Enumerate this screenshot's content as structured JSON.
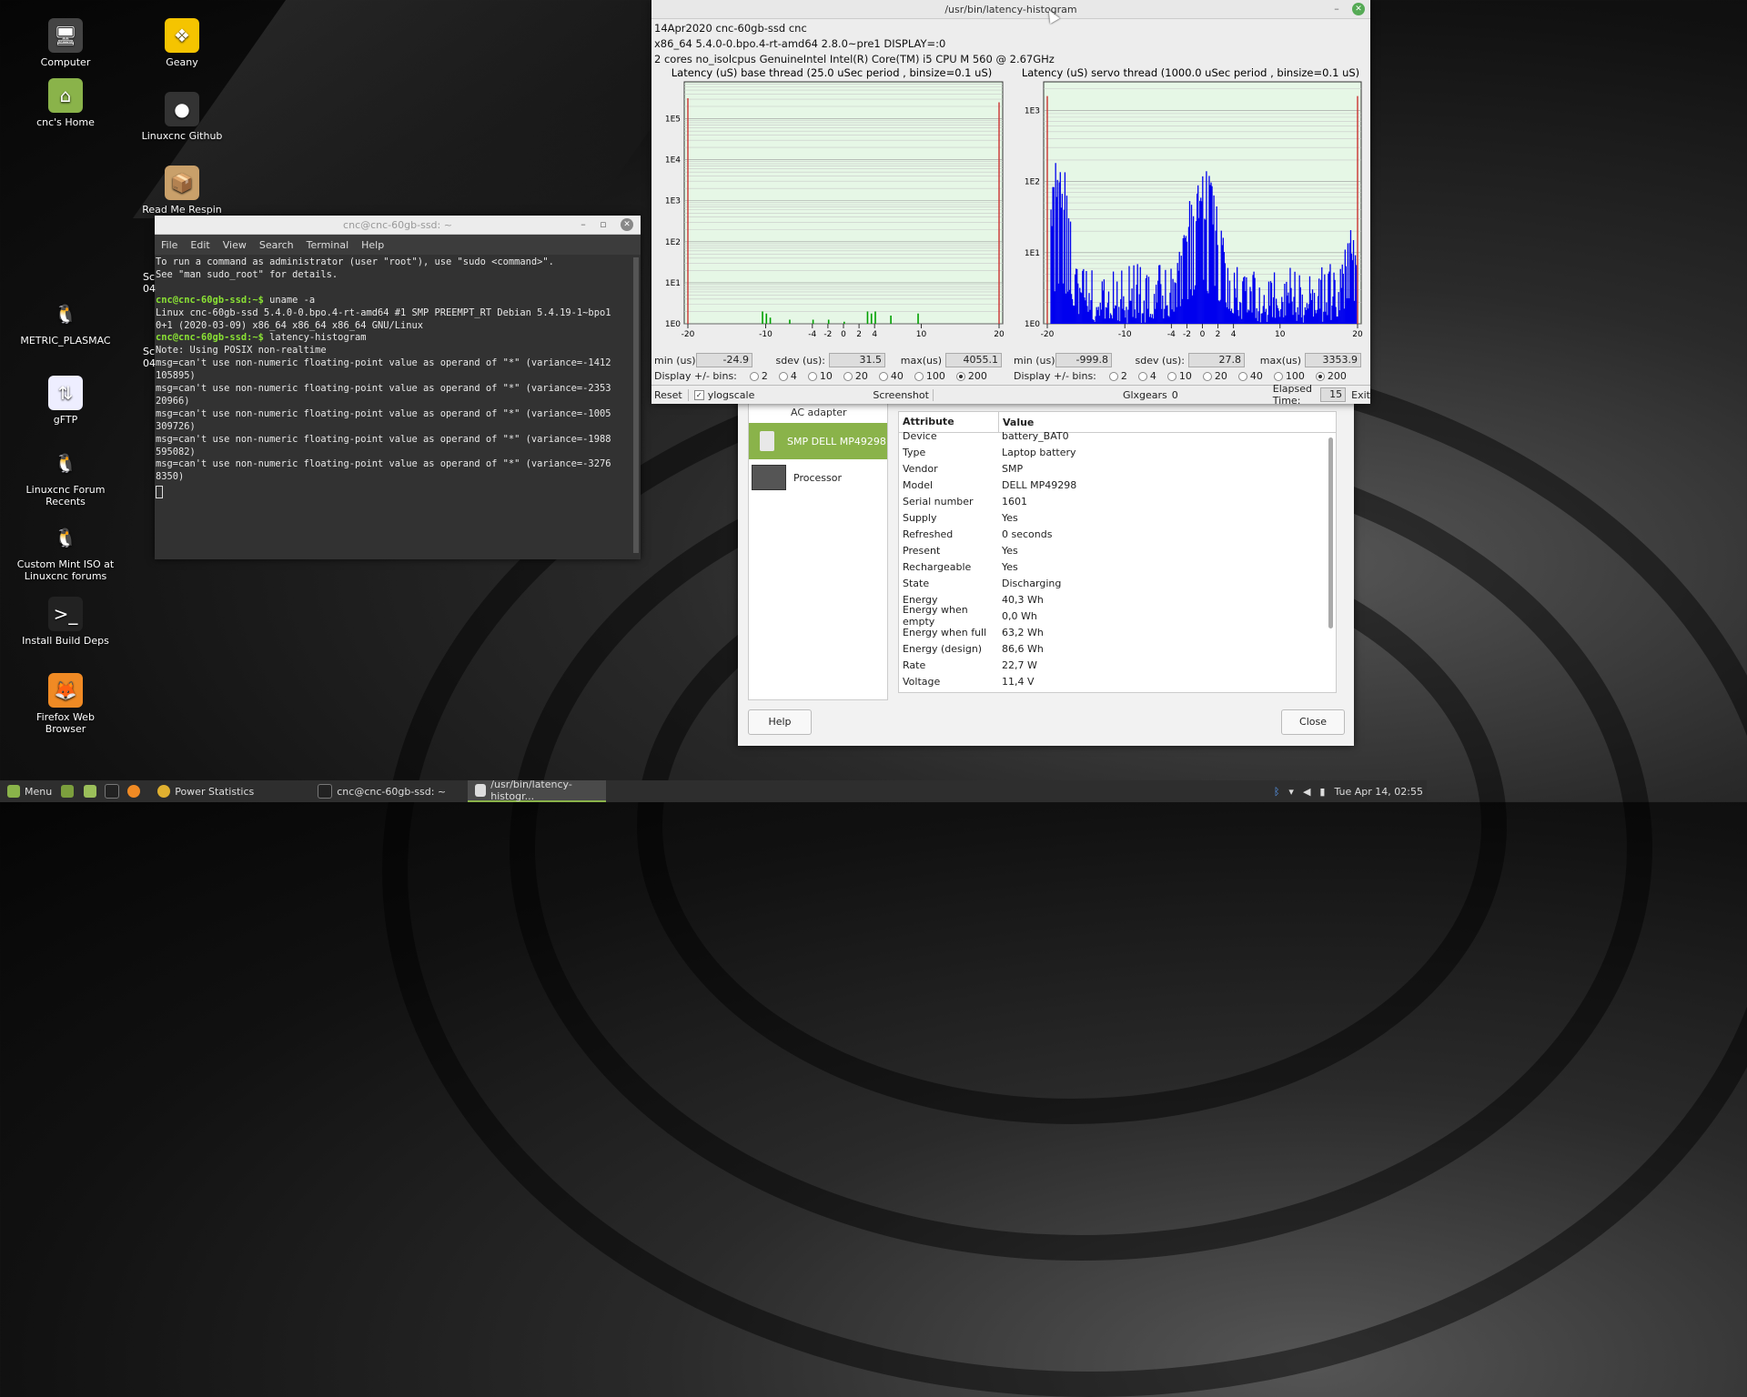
{
  "desktop": {
    "icons": [
      {
        "label": "Computer",
        "glyph": "🖥"
      },
      {
        "label": "cnc's Home",
        "glyph": "⌂"
      },
      {
        "label": "Geany",
        "glyph": "❖"
      },
      {
        "label": "Linuxcnc Github",
        "glyph": "●"
      },
      {
        "label": "Read Me Respin",
        "glyph": "📦"
      },
      {
        "label": "METRIC_PLASMAC",
        "glyph": "🐧"
      },
      {
        "label": "gFTP",
        "glyph": "⇅"
      },
      {
        "label": "Linuxcnc Forum Recents",
        "glyph": "🐧"
      },
      {
        "label": "Custom Mint ISO at Linuxcnc forums",
        "glyph": "🐧"
      },
      {
        "label": "Install Build Deps",
        "glyph": ">_"
      },
      {
        "label": "Firefox Web Browser",
        "glyph": "🦊"
      }
    ]
  },
  "terminal": {
    "title": "cnc@cnc-60gb-ssd: ~",
    "menu": [
      "File",
      "Edit",
      "View",
      "Search",
      "Terminal",
      "Help"
    ],
    "lines": [
      {
        "t": "To run a command as administrator (user \"root\"), use \"sudo <command>\"."
      },
      {
        "t": "See \"man sudo_root\" for details."
      },
      {
        "t": ""
      },
      {
        "p": "cnc@cnc-60gb-ssd:~$",
        "t": " uname -a"
      },
      {
        "t": "Linux cnc-60gb-ssd 5.4.0-0.bpo.4-rt-amd64 #1 SMP PREEMPT_RT Debian 5.4.19-1~bpo1"
      },
      {
        "t": "0+1 (2020-03-09) x86_64 x86_64 x86_64 GNU/Linux"
      },
      {
        "p": "cnc@cnc-60gb-ssd:~$",
        "t": " latency-histogram"
      },
      {
        "t": "Note: Using POSIX non-realtime"
      },
      {
        "t": "msg=can't use non-numeric floating-point value as operand of \"*\" (variance=-1412"
      },
      {
        "t": "105895)"
      },
      {
        "t": "msg=can't use non-numeric floating-point value as operand of \"*\" (variance=-2353"
      },
      {
        "t": "20966)"
      },
      {
        "t": "msg=can't use non-numeric floating-point value as operand of \"*\" (variance=-1005"
      },
      {
        "t": "309726)"
      },
      {
        "t": "msg=can't use non-numeric floating-point value as operand of \"*\" (variance=-1988"
      },
      {
        "t": "595082)"
      },
      {
        "t": "msg=can't use non-numeric floating-point value as operand of \"*\" (variance=-3276"
      },
      {
        "t": "8350)"
      }
    ],
    "partial_left": [
      "Sc",
      "04",
      "Sc",
      "04"
    ]
  },
  "latency": {
    "title": "/usr/bin/latency-histogram",
    "info": [
      "14Apr2020 cnc-60gb-ssd cnc",
      "x86_64  5.4.0-0.bpo.4-rt-amd64  2.8.0~pre1  DISPLAY=:0",
      "2 cores  no_isolcpus   GenuineIntel  Intel(R) Core(TM) i5 CPU M 560 @ 2.67GHz"
    ],
    "base": {
      "title": "Latency (uS) base thread (25.0 uSec period , binsize=0.1 uS)",
      "min_label": "min (us)",
      "min": "-24.9",
      "sdev_label": "sdev (us):",
      "sdev": "31.5",
      "max_label": "max(us)",
      "max": "4055.1"
    },
    "servo": {
      "title": "Latency (uS) servo thread (1000.0 uSec period , binsize=0.1 uS)",
      "min_label": "min (us)",
      "min": "-999.8",
      "sdev_label": "sdev (us):",
      "sdev": "27.8",
      "max_label": "max(us)",
      "max": "3353.9"
    },
    "bins_label": "Display +/- bins:",
    "bins": [
      "2",
      "4",
      "10",
      "20",
      "40",
      "100",
      "200"
    ],
    "bins_selected": "200",
    "reset": "Reset",
    "ylogscale": "ylogscale",
    "screenshot": "Screenshot",
    "glxgears_label": "Glxgears",
    "glxgears": "0",
    "elapsed_label": "Elapsed Time:",
    "elapsed": "15",
    "exit": "Exit"
  },
  "chart_data": [
    {
      "type": "bar",
      "title": "Latency (uS) base thread (25.0 uSec period , binsize=0.1 uS)",
      "x_ticks": [
        "-20",
        "-10",
        "-4",
        "-2",
        "0",
        "2",
        "4",
        "10",
        "20"
      ],
      "y_ticks": [
        "1E0",
        "1E1",
        "1E2",
        "1E3",
        "1E4",
        "1E5"
      ],
      "yscale": "log",
      "xlim": [
        -20,
        20
      ],
      "grid": true,
      "spikes": [
        {
          "x": -20,
          "log10": 5.5
        },
        {
          "x": 20,
          "log10": 5.4
        }
      ],
      "bars": [
        [
          -10.5,
          0.3
        ],
        [
          -10,
          0.25
        ],
        [
          -9.5,
          0.15
        ],
        [
          -7,
          0.1
        ],
        [
          -4,
          0.1
        ],
        [
          -2,
          0.1
        ],
        [
          0,
          0.05
        ],
        [
          3,
          0.3
        ],
        [
          3.5,
          0.25
        ],
        [
          4,
          0.3
        ],
        [
          6,
          0.2
        ],
        [
          9.5,
          0.25
        ]
      ]
    },
    {
      "type": "bar",
      "title": "Latency (uS) servo thread (1000.0 uSec period , binsize=0.1 uS)",
      "x_ticks": [
        "-20",
        "-10",
        "-4",
        "-2",
        "0",
        "2",
        "4",
        "10",
        "20"
      ],
      "y_ticks": [
        "1E0",
        "1E1",
        "1E2",
        "1E3"
      ],
      "yscale": "log",
      "xlim": [
        -20,
        20
      ],
      "grid": true,
      "spikes": [
        {
          "x": -20,
          "log10": 3.2
        },
        {
          "x": 20,
          "log10": 3.2
        }
      ],
      "peaks": [
        {
          "center": -18.5,
          "log10": 2.3,
          "width": 2.2
        },
        {
          "center": 0,
          "log10": 2.1,
          "width": 3.5
        },
        {
          "center": 19,
          "log10": 1.3,
          "width": 1.4
        }
      ],
      "floor_log10": 0.6
    }
  ],
  "power": {
    "devices": [
      {
        "label": "AC adapter"
      },
      {
        "label": "SMP DELL MP49298"
      },
      {
        "label": "Processor"
      }
    ],
    "header": {
      "attr": "Attribute",
      "value": "Value"
    },
    "rows": [
      {
        "a": "Device",
        "v": "battery_BAT0"
      },
      {
        "a": "Type",
        "v": "Laptop battery"
      },
      {
        "a": "Vendor",
        "v": "SMP"
      },
      {
        "a": "Model",
        "v": "DELL MP49298"
      },
      {
        "a": "Serial number",
        "v": "1601"
      },
      {
        "a": "Supply",
        "v": "Yes"
      },
      {
        "a": "Refreshed",
        "v": "0 seconds"
      },
      {
        "a": "Present",
        "v": "Yes"
      },
      {
        "a": "Rechargeable",
        "v": "Yes"
      },
      {
        "a": "State",
        "v": "Discharging"
      },
      {
        "a": "Energy",
        "v": "40,3 Wh"
      },
      {
        "a": "Energy when empty",
        "v": "0,0 Wh"
      },
      {
        "a": "Energy when full",
        "v": "63,2 Wh"
      },
      {
        "a": "Energy (design)",
        "v": "86,6 Wh"
      },
      {
        "a": "Rate",
        "v": "22,7 W"
      },
      {
        "a": "Voltage",
        "v": "11,4 V"
      }
    ],
    "help": "Help",
    "close": "Close"
  },
  "taskbar": {
    "menu": "Menu",
    "tasks": [
      "Power Statistics",
      "cnc@cnc-60gb-ssd: ~",
      "/usr/bin/latency-histogr..."
    ],
    "clock": "Tue Apr 14, 02:55"
  },
  "colors": {
    "accent": "#8ab34a",
    "histogram_bar": "#0000ee",
    "plot_bg": "#e6f7e6"
  }
}
